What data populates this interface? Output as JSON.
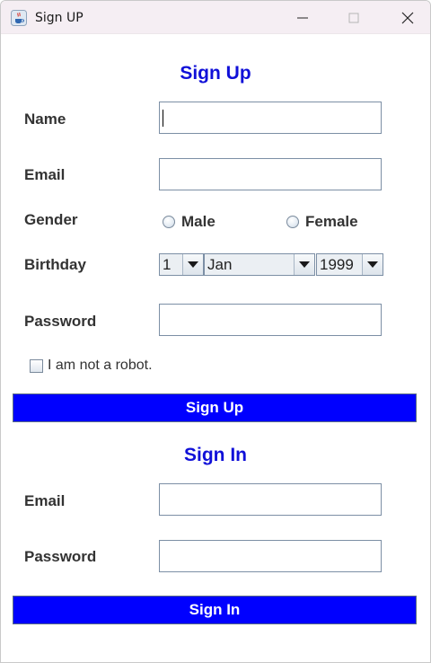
{
  "window": {
    "title": "Sign UP",
    "app_icon": "java-cup-icon"
  },
  "signup": {
    "heading": "Sign Up",
    "name_label": "Name",
    "name_value": "",
    "email_label": "Email",
    "email_value": "",
    "gender_label": "Gender",
    "gender_options": [
      "Male",
      "Female"
    ],
    "birthday_label": "Birthday",
    "day": "1",
    "month": "Jan",
    "year": "1999",
    "password_label": "Password",
    "password_value": "",
    "robot_label": "I am  not a robot.",
    "robot_checked": false,
    "button_label": "Sign Up"
  },
  "signin": {
    "heading": "Sign In",
    "email_label": "Email",
    "email_value": "",
    "password_label": "Password",
    "password_value": "",
    "button_label": "Sign In"
  },
  "colors": {
    "accent": "#0000ff",
    "heading": "#1010d8",
    "label": "#333333"
  }
}
